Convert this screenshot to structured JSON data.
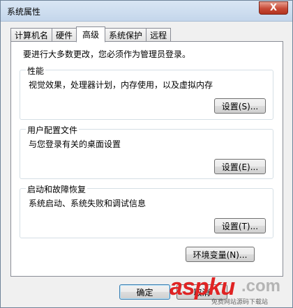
{
  "window": {
    "title": "系统属性",
    "close_glyph": "X"
  },
  "tabs": [
    {
      "label": "计算机名",
      "active": false
    },
    {
      "label": "硬件",
      "active": false
    },
    {
      "label": "高级",
      "active": true
    },
    {
      "label": "系统保护",
      "active": false
    },
    {
      "label": "远程",
      "active": false
    }
  ],
  "panel": {
    "admin_note": "要进行大多数更改，您必须作为管理员登录。",
    "performance": {
      "legend": "性能",
      "description": "视觉效果，处理器计划，内存使用，以及虚拟内存",
      "button": "设置(S)..."
    },
    "user_profiles": {
      "legend": "用户配置文件",
      "description": "与您登录有关的桌面设置",
      "button": "设置(E)..."
    },
    "startup_recovery": {
      "legend": "启动和故障恢复",
      "description": "系统启动、系统失败和调试信息",
      "button": "设置(T)..."
    },
    "env_vars_button": "环境变量(N)..."
  },
  "footer": {
    "ok_button": "确定",
    "cancel_button": "取消"
  },
  "watermark": {
    "brand": "aspku",
    "tld": ".com",
    "tagline": "免费网站源码下载站"
  },
  "colors": {
    "close_red": "#c74a37",
    "watermark_red": "#e02323"
  }
}
